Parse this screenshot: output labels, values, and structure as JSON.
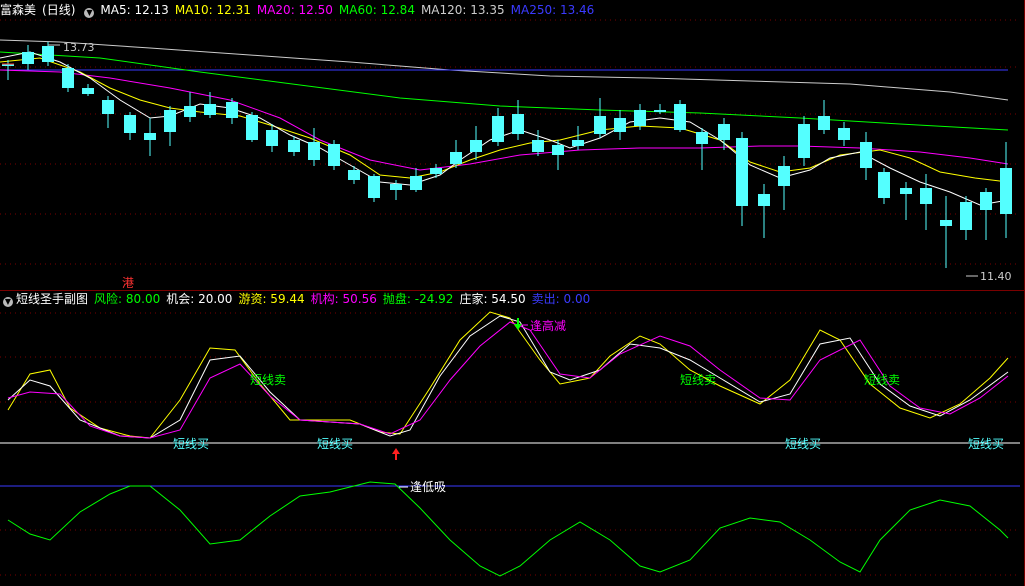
{
  "main_chart": {
    "stock_name": "富森美",
    "period_label": "(日线)",
    "ma_indicators": [
      {
        "label": "MA5: 12.13",
        "color": "#ffffff"
      },
      {
        "label": "MA10: 12.31",
        "color": "#ffff00"
      },
      {
        "label": "MA20: 12.50",
        "color": "#ff00ff"
      },
      {
        "label": "MA60: 12.84",
        "color": "#00ff00"
      },
      {
        "label": "MA120: 13.35",
        "color": "#cccccc"
      },
      {
        "label": "MA250: 13.46",
        "color": "#3a3aff"
      }
    ],
    "high_marker": "13.73",
    "low_marker": "11.40",
    "hk_badge": "港"
  },
  "sub_chart": {
    "title": "短线圣手副图",
    "indicators": [
      {
        "label": "风险: 80.00",
        "color": "#00ff00"
      },
      {
        "label": "机会: 20.00",
        "color": "#ffffff"
      },
      {
        "label": "游资: 59.44",
        "color": "#ffff00"
      },
      {
        "label": "机构: 50.56",
        "color": "#ff00ff"
      },
      {
        "label": "抛盘: -24.92",
        "color": "#00ff00"
      },
      {
        "label": "庄家: 54.50",
        "color": "#ffffff"
      },
      {
        "label": "卖出: 0.00",
        "color": "#3a3aff"
      }
    ],
    "annotations": {
      "sell_top": "逢高减",
      "buy_low": "逢低吸",
      "short_sell": "短线卖",
      "short_buy": "短线买"
    }
  },
  "colors": {
    "up": "#ff3232",
    "down": "#54ffff",
    "grid": "#7a0000",
    "yellow": "#ffff00",
    "magenta": "#ff00ff",
    "green": "#00ff00",
    "blue": "#3a3aff",
    "white": "#ffffff"
  }
}
